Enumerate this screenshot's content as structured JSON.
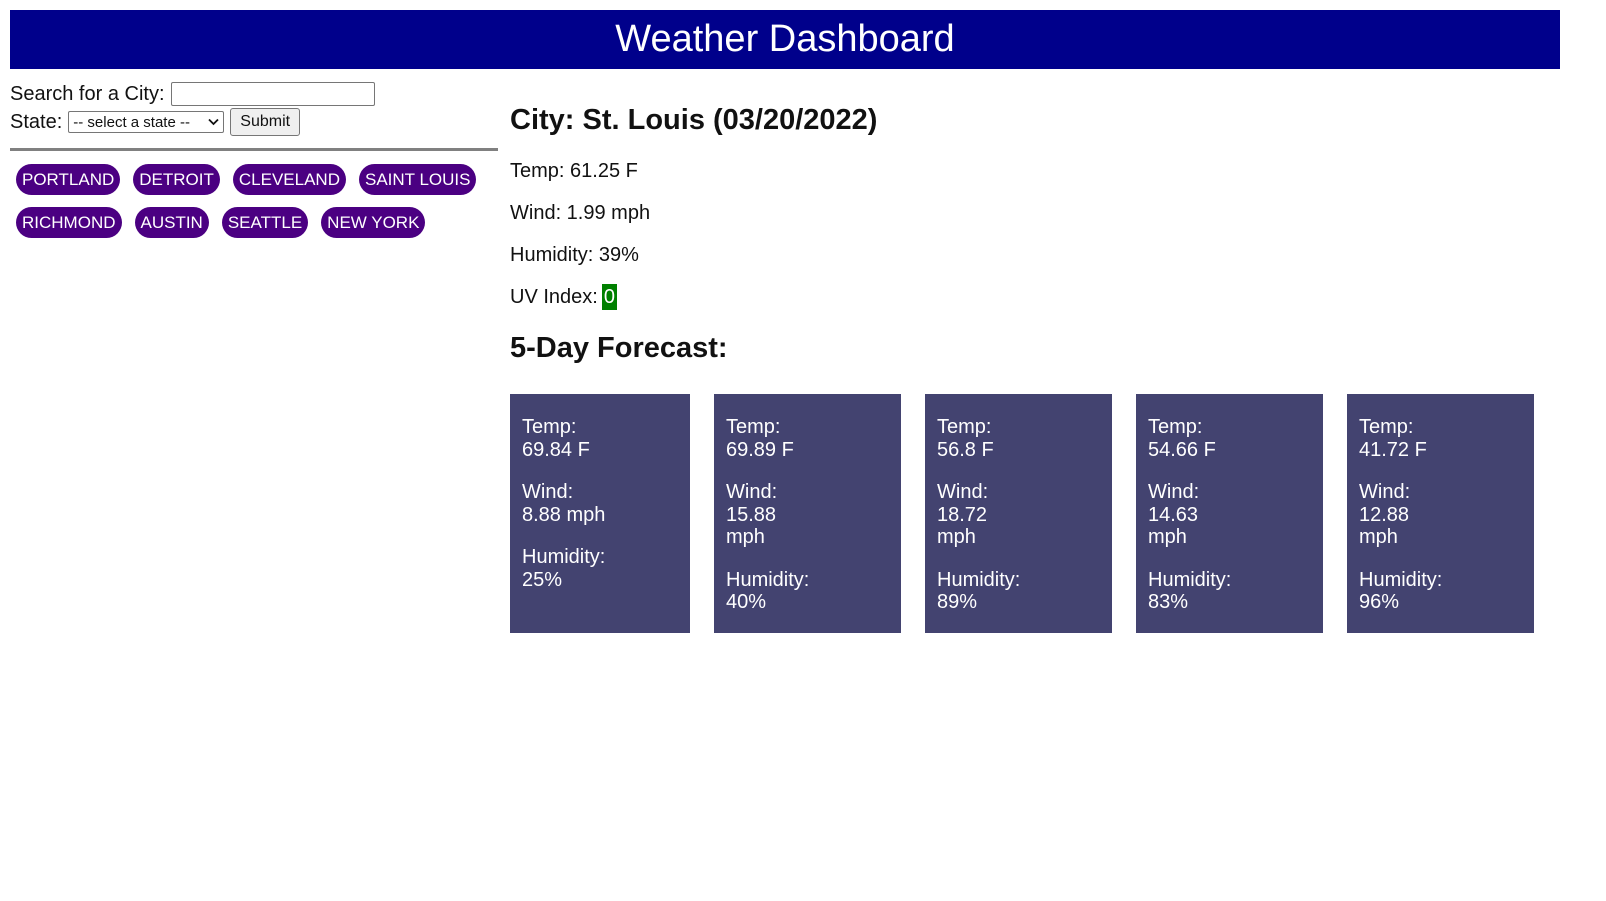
{
  "header": {
    "title": "Weather Dashboard"
  },
  "search": {
    "city_label": "Search for a City:",
    "city_value": "",
    "city_placeholder": "",
    "state_label": "State:",
    "state_selected": "-- select a state --",
    "submit_label": "Submit"
  },
  "history": [
    "PORTLAND",
    "DETROIT",
    "CLEVELAND",
    "SAINT LOUIS",
    "RICHMOND",
    "AUSTIN",
    "SEATTLE",
    "NEW YORK"
  ],
  "current": {
    "title": "City: St. Louis (03/20/2022)",
    "temp": "Temp: 61.25 F",
    "wind": "Wind: 1.99 mph",
    "humidity": "Humidity: 39%",
    "uv_label": "UV Index:",
    "uv_value": "0",
    "uv_color": "#008000"
  },
  "forecast": {
    "title": "5-Day Forecast:",
    "temp_label": "Temp:",
    "wind_label": "Wind:",
    "humidity_label": "Humidity:",
    "days": [
      {
        "temp": "69.84 F",
        "wind": "8.88 mph",
        "humidity": "25%"
      },
      {
        "temp": "69.89 F",
        "wind": "15.88 mph",
        "humidity": "40%"
      },
      {
        "temp": "56.8 F",
        "wind": "18.72 mph",
        "humidity": "89%"
      },
      {
        "temp": "54.66 F",
        "wind": "14.63 mph",
        "humidity": "83%"
      },
      {
        "temp": "41.72 F",
        "wind": "12.88 mph",
        "humidity": "96%"
      }
    ]
  },
  "colors": {
    "header_bg": "#00008b",
    "city_button_bg": "#4b0082",
    "card_bg": "#434370"
  }
}
